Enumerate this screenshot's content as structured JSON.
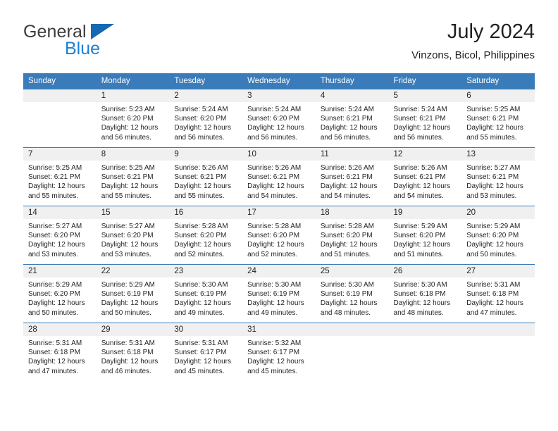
{
  "brand": {
    "name_top": "General",
    "name_bottom": "Blue",
    "triangle_color": "#1668b3",
    "blue_color": "#1b7fd4",
    "gray_color": "#3c3c3c"
  },
  "header": {
    "title": "July 2024",
    "subtitle": "Vinzons, Bicol, Philippines"
  },
  "calendar": {
    "header_bg": "#3a7cba",
    "header_text_color": "#ffffff",
    "daynum_band_bg": "#f0f0f0",
    "weekday_headers": [
      "Sunday",
      "Monday",
      "Tuesday",
      "Wednesday",
      "Thursday",
      "Friday",
      "Saturday"
    ],
    "weeks": [
      [
        {
          "day": "",
          "sunrise": "",
          "sunset": "",
          "daylight_line1": "",
          "daylight_line2": ""
        },
        {
          "day": "1",
          "sunrise": "Sunrise: 5:23 AM",
          "sunset": "Sunset: 6:20 PM",
          "daylight_line1": "Daylight: 12 hours",
          "daylight_line2": "and 56 minutes."
        },
        {
          "day": "2",
          "sunrise": "Sunrise: 5:24 AM",
          "sunset": "Sunset: 6:20 PM",
          "daylight_line1": "Daylight: 12 hours",
          "daylight_line2": "and 56 minutes."
        },
        {
          "day": "3",
          "sunrise": "Sunrise: 5:24 AM",
          "sunset": "Sunset: 6:20 PM",
          "daylight_line1": "Daylight: 12 hours",
          "daylight_line2": "and 56 minutes."
        },
        {
          "day": "4",
          "sunrise": "Sunrise: 5:24 AM",
          "sunset": "Sunset: 6:21 PM",
          "daylight_line1": "Daylight: 12 hours",
          "daylight_line2": "and 56 minutes."
        },
        {
          "day": "5",
          "sunrise": "Sunrise: 5:24 AM",
          "sunset": "Sunset: 6:21 PM",
          "daylight_line1": "Daylight: 12 hours",
          "daylight_line2": "and 56 minutes."
        },
        {
          "day": "6",
          "sunrise": "Sunrise: 5:25 AM",
          "sunset": "Sunset: 6:21 PM",
          "daylight_line1": "Daylight: 12 hours",
          "daylight_line2": "and 55 minutes."
        }
      ],
      [
        {
          "day": "7",
          "sunrise": "Sunrise: 5:25 AM",
          "sunset": "Sunset: 6:21 PM",
          "daylight_line1": "Daylight: 12 hours",
          "daylight_line2": "and 55 minutes."
        },
        {
          "day": "8",
          "sunrise": "Sunrise: 5:25 AM",
          "sunset": "Sunset: 6:21 PM",
          "daylight_line1": "Daylight: 12 hours",
          "daylight_line2": "and 55 minutes."
        },
        {
          "day": "9",
          "sunrise": "Sunrise: 5:26 AM",
          "sunset": "Sunset: 6:21 PM",
          "daylight_line1": "Daylight: 12 hours",
          "daylight_line2": "and 55 minutes."
        },
        {
          "day": "10",
          "sunrise": "Sunrise: 5:26 AM",
          "sunset": "Sunset: 6:21 PM",
          "daylight_line1": "Daylight: 12 hours",
          "daylight_line2": "and 54 minutes."
        },
        {
          "day": "11",
          "sunrise": "Sunrise: 5:26 AM",
          "sunset": "Sunset: 6:21 PM",
          "daylight_line1": "Daylight: 12 hours",
          "daylight_line2": "and 54 minutes."
        },
        {
          "day": "12",
          "sunrise": "Sunrise: 5:26 AM",
          "sunset": "Sunset: 6:21 PM",
          "daylight_line1": "Daylight: 12 hours",
          "daylight_line2": "and 54 minutes."
        },
        {
          "day": "13",
          "sunrise": "Sunrise: 5:27 AM",
          "sunset": "Sunset: 6:21 PM",
          "daylight_line1": "Daylight: 12 hours",
          "daylight_line2": "and 53 minutes."
        }
      ],
      [
        {
          "day": "14",
          "sunrise": "Sunrise: 5:27 AM",
          "sunset": "Sunset: 6:20 PM",
          "daylight_line1": "Daylight: 12 hours",
          "daylight_line2": "and 53 minutes."
        },
        {
          "day": "15",
          "sunrise": "Sunrise: 5:27 AM",
          "sunset": "Sunset: 6:20 PM",
          "daylight_line1": "Daylight: 12 hours",
          "daylight_line2": "and 53 minutes."
        },
        {
          "day": "16",
          "sunrise": "Sunrise: 5:28 AM",
          "sunset": "Sunset: 6:20 PM",
          "daylight_line1": "Daylight: 12 hours",
          "daylight_line2": "and 52 minutes."
        },
        {
          "day": "17",
          "sunrise": "Sunrise: 5:28 AM",
          "sunset": "Sunset: 6:20 PM",
          "daylight_line1": "Daylight: 12 hours",
          "daylight_line2": "and 52 minutes."
        },
        {
          "day": "18",
          "sunrise": "Sunrise: 5:28 AM",
          "sunset": "Sunset: 6:20 PM",
          "daylight_line1": "Daylight: 12 hours",
          "daylight_line2": "and 51 minutes."
        },
        {
          "day": "19",
          "sunrise": "Sunrise: 5:29 AM",
          "sunset": "Sunset: 6:20 PM",
          "daylight_line1": "Daylight: 12 hours",
          "daylight_line2": "and 51 minutes."
        },
        {
          "day": "20",
          "sunrise": "Sunrise: 5:29 AM",
          "sunset": "Sunset: 6:20 PM",
          "daylight_line1": "Daylight: 12 hours",
          "daylight_line2": "and 50 minutes."
        }
      ],
      [
        {
          "day": "21",
          "sunrise": "Sunrise: 5:29 AM",
          "sunset": "Sunset: 6:20 PM",
          "daylight_line1": "Daylight: 12 hours",
          "daylight_line2": "and 50 minutes."
        },
        {
          "day": "22",
          "sunrise": "Sunrise: 5:29 AM",
          "sunset": "Sunset: 6:19 PM",
          "daylight_line1": "Daylight: 12 hours",
          "daylight_line2": "and 50 minutes."
        },
        {
          "day": "23",
          "sunrise": "Sunrise: 5:30 AM",
          "sunset": "Sunset: 6:19 PM",
          "daylight_line1": "Daylight: 12 hours",
          "daylight_line2": "and 49 minutes."
        },
        {
          "day": "24",
          "sunrise": "Sunrise: 5:30 AM",
          "sunset": "Sunset: 6:19 PM",
          "daylight_line1": "Daylight: 12 hours",
          "daylight_line2": "and 49 minutes."
        },
        {
          "day": "25",
          "sunrise": "Sunrise: 5:30 AM",
          "sunset": "Sunset: 6:19 PM",
          "daylight_line1": "Daylight: 12 hours",
          "daylight_line2": "and 48 minutes."
        },
        {
          "day": "26",
          "sunrise": "Sunrise: 5:30 AM",
          "sunset": "Sunset: 6:18 PM",
          "daylight_line1": "Daylight: 12 hours",
          "daylight_line2": "and 48 minutes."
        },
        {
          "day": "27",
          "sunrise": "Sunrise: 5:31 AM",
          "sunset": "Sunset: 6:18 PM",
          "daylight_line1": "Daylight: 12 hours",
          "daylight_line2": "and 47 minutes."
        }
      ],
      [
        {
          "day": "28",
          "sunrise": "Sunrise: 5:31 AM",
          "sunset": "Sunset: 6:18 PM",
          "daylight_line1": "Daylight: 12 hours",
          "daylight_line2": "and 47 minutes."
        },
        {
          "day": "29",
          "sunrise": "Sunrise: 5:31 AM",
          "sunset": "Sunset: 6:18 PM",
          "daylight_line1": "Daylight: 12 hours",
          "daylight_line2": "and 46 minutes."
        },
        {
          "day": "30",
          "sunrise": "Sunrise: 5:31 AM",
          "sunset": "Sunset: 6:17 PM",
          "daylight_line1": "Daylight: 12 hours",
          "daylight_line2": "and 45 minutes."
        },
        {
          "day": "31",
          "sunrise": "Sunrise: 5:32 AM",
          "sunset": "Sunset: 6:17 PM",
          "daylight_line1": "Daylight: 12 hours",
          "daylight_line2": "and 45 minutes."
        },
        {
          "day": "",
          "sunrise": "",
          "sunset": "",
          "daylight_line1": "",
          "daylight_line2": ""
        },
        {
          "day": "",
          "sunrise": "",
          "sunset": "",
          "daylight_line1": "",
          "daylight_line2": ""
        },
        {
          "day": "",
          "sunrise": "",
          "sunset": "",
          "daylight_line1": "",
          "daylight_line2": ""
        }
      ]
    ]
  }
}
